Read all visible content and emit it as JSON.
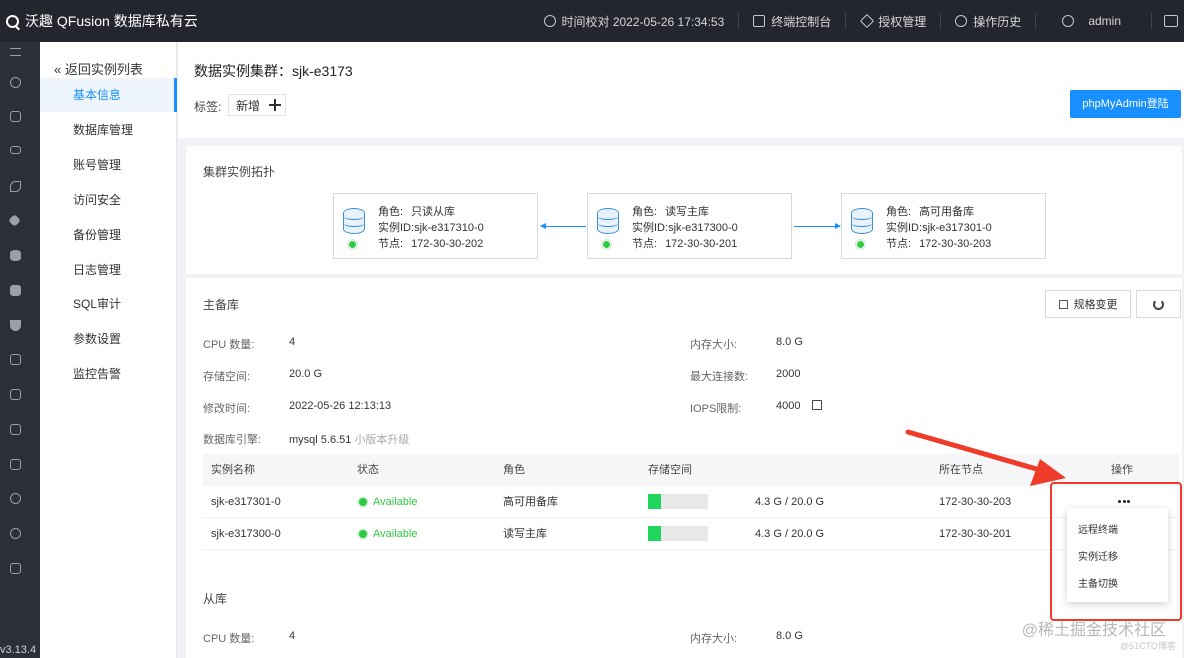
{
  "app": {
    "title": "沃趣 QFusion 数据库私有云"
  },
  "topbar": {
    "time_label": "时间校对 2022-05-26 17:34:53",
    "terminal_label": "终端控制台",
    "license_label": "授权管理",
    "history_label": "操作历史",
    "user_label": "admin"
  },
  "version": "v3.13.4",
  "submenu": {
    "back_label": "返回实例列表",
    "items": [
      "基本信息",
      "数据库管理",
      "账号管理",
      "访问安全",
      "备份管理",
      "日志管理",
      "SQL审计",
      "参数设置",
      "监控告警"
    ],
    "active_index": 0
  },
  "header": {
    "title": "数据实例集群：sjk-e3173",
    "tag_label": "标签:",
    "tag_add_label": "新增",
    "phpmyadmin_label": "phpMyAdmin登陆"
  },
  "topology": {
    "title": "集群实例拓扑",
    "role_key": "角色:",
    "id_key": "实例ID:",
    "node_key": "节点:",
    "nodes": [
      {
        "role": "只读从库",
        "id": "sjk-e317310-0",
        "node": "172-30-30-202"
      },
      {
        "role": "读写主库",
        "id": "sjk-e317300-0",
        "node": "172-30-30-201"
      },
      {
        "role": "高可用备库",
        "id": "sjk-e317301-0",
        "node": "172-30-30-203"
      }
    ]
  },
  "primary": {
    "title": "主备库",
    "spec_button": "规格变更",
    "cpu_key": "CPU 数量:",
    "cpu_value": "4",
    "storage_key": "存储空间:",
    "storage_value": "20.0 G",
    "mtime_key": "修改时间:",
    "mtime_value": "2022-05-26 12:13:13",
    "engine_key": "数据库引擎:",
    "engine_value": "mysql 5.6.51",
    "engine_hint": "小版本升级",
    "mem_key": "内存大小:",
    "mem_value": "8.0 G",
    "conn_key": "最大连接数:",
    "conn_value": "2000",
    "iops_key": "IOPS限制:",
    "iops_value": "4000",
    "table": {
      "headers": [
        "实例名称",
        "状态",
        "角色",
        "存储空间",
        "所在节点",
        "操作"
      ],
      "rows": [
        {
          "name": "sjk-e317301-0",
          "status": "Available",
          "role": "高可用备库",
          "storage": "4.3 G / 20.0 G",
          "usage": 0.215,
          "node": "172-30-30-203"
        },
        {
          "name": "sjk-e317300-0",
          "status": "Available",
          "role": "读写主库",
          "storage": "4.3 G / 20.0 G",
          "usage": 0.215,
          "node": "172-30-30-201"
        }
      ]
    },
    "dropdown": [
      "远程终端",
      "实例迁移",
      "主备切换"
    ]
  },
  "replica": {
    "title": "从库",
    "cpu_key": "CPU 数量:",
    "cpu_value": "4",
    "mem_key": "内存大小:",
    "mem_value": "8.0 G"
  },
  "watermark": {
    "main": "@稀土掘金技术社区",
    "sub": "@51CTO博客"
  },
  "colors": {
    "accent": "#1890ff",
    "status_ok": "#2ecc40",
    "annotation": "#ee3b2a",
    "topbar": "#23262e"
  }
}
